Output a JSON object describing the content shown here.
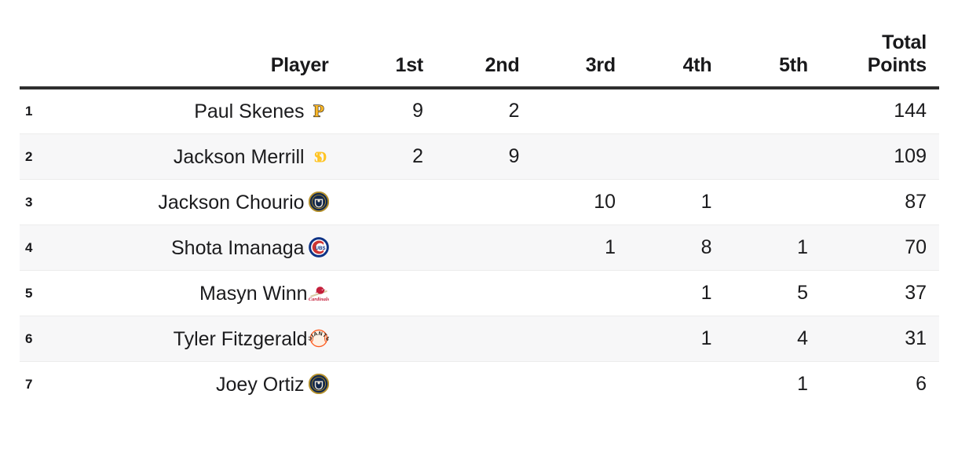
{
  "table": {
    "headers": {
      "rank": "",
      "player": "Player",
      "first": "1st",
      "second": "2nd",
      "third": "3rd",
      "fourth": "4th",
      "fifth": "5th",
      "total_line1": "Total",
      "total_line2": "Points"
    },
    "rows": [
      {
        "rank": "1",
        "player": "Paul Skenes",
        "team_logo": "pirates-logo",
        "first": "9",
        "second": "2",
        "third": "",
        "fourth": "",
        "fifth": "",
        "total": "144"
      },
      {
        "rank": "2",
        "player": "Jackson Merrill",
        "team_logo": "padres-logo",
        "first": "2",
        "second": "9",
        "third": "",
        "fourth": "",
        "fifth": "",
        "total": "109"
      },
      {
        "rank": "3",
        "player": "Jackson Chourio",
        "team_logo": "brewers-logo",
        "first": "",
        "second": "",
        "third": "10",
        "fourth": "1",
        "fifth": "",
        "total": "87"
      },
      {
        "rank": "4",
        "player": "Shota Imanaga",
        "team_logo": "cubs-logo",
        "first": "",
        "second": "",
        "third": "1",
        "fourth": "8",
        "fifth": "1",
        "total": "70"
      },
      {
        "rank": "5",
        "player": "Masyn Winn",
        "team_logo": "cardinals-logo",
        "first": "",
        "second": "",
        "third": "",
        "fourth": "1",
        "fifth": "5",
        "total": "37"
      },
      {
        "rank": "6",
        "player": "Tyler Fitzgerald",
        "team_logo": "giants-logo",
        "first": "",
        "second": "",
        "third": "",
        "fourth": "1",
        "fifth": "4",
        "total": "31"
      },
      {
        "rank": "7",
        "player": "Joey Ortiz",
        "team_logo": "brewers-logo",
        "first": "",
        "second": "",
        "third": "",
        "fourth": "",
        "fifth": "1",
        "total": "6"
      }
    ]
  },
  "colors": {
    "header_rule": "#2e2e2e",
    "row_divider": "#ececec",
    "alt_row_bg": "#f7f7f8",
    "text": "#1b1b1d",
    "pirates_gold": "#fdb827",
    "padres_gold": "#ffc425",
    "brewers_navy": "#12284c",
    "brewers_gold": "#b6922e",
    "cubs_blue": "#0e3386",
    "cubs_red": "#cc3433",
    "cardinals_red": "#c41e3a",
    "giants_orange": "#fd5a1e",
    "giants_black": "#27251f"
  }
}
